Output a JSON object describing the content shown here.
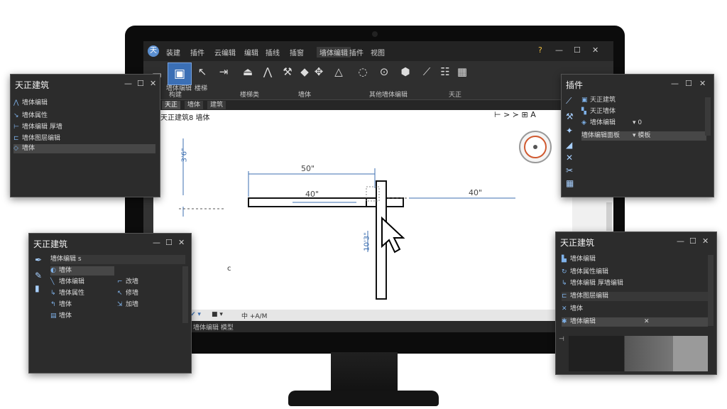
{
  "app": {
    "logo": "天"
  },
  "menus": [
    "装建",
    "插件",
    "云编辑",
    "编辑",
    "插线",
    "插窗",
    "墙体编辑",
    "插件",
    "视图"
  ],
  "window_controls": {
    "help": "?",
    "minimize": "—",
    "restore": "☐",
    "close": "✕"
  },
  "ribbon": {
    "groups": [
      {
        "label": "墙体编辑"
      },
      {
        "label": "构建"
      },
      {
        "label": "楼梯类"
      },
      {
        "label": "墙体"
      },
      {
        "label": "其他墙体编辑"
      },
      {
        "label": "天正"
      }
    ],
    "group1_label2": "楼梯"
  },
  "doc_tabs": [
    "天正",
    "墙体",
    "建筑"
  ],
  "canvas": {
    "header_text": "天正建筑8 墙体",
    "dim_top": "50\"",
    "dim_mid": "40\"",
    "dim_right": "40\"",
    "dim_left_vertical": "3'6\"",
    "dim_lower_vertical": "10'3\"",
    "corner_letter": "c"
  },
  "status": {
    "text": "中 +A/M"
  },
  "bottom": {
    "text": "墙体编辑 模型"
  },
  "panels": {
    "top_left": {
      "title": "天正建筑",
      "rows": [
        "墙体编辑",
        "墙体属性",
        "墙体编辑 厚墙",
        "墙体图层编辑",
        "墙体"
      ]
    },
    "bottom_left": {
      "title": "天正建筑",
      "subheader": "墙体编辑 s",
      "rows_col1": [
        "墙体",
        "墙体编辑",
        "墙体属性",
        "墙体",
        "墙体"
      ],
      "rows_col2": [
        "改墙",
        "修墙",
        "加墙"
      ]
    },
    "top_right": {
      "title": "插件",
      "rows": [
        "天正建筑",
        "天正墙体",
        "墙体编辑",
        "墙体编辑面板"
      ],
      "side_values": [
        "0",
        "模板"
      ]
    },
    "bottom_right": {
      "title": "天正建筑",
      "rows": [
        "墙体编辑",
        "墙体属性编辑",
        "墙体编辑 厚墙编辑",
        "墙体图层编辑",
        "墙体",
        "墙体编辑"
      ]
    }
  }
}
